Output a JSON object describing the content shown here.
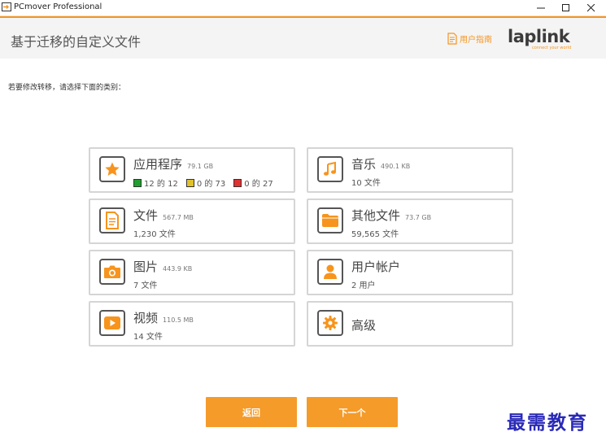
{
  "window": {
    "title": "PCmover Professional"
  },
  "header": {
    "title": "基于迁移的自定义文件",
    "guide_label": "用户指南",
    "logo_text": "laplink",
    "logo_tagline": "connect your world"
  },
  "instruction": "若要修改转移，请选择下面的类别：",
  "categories": [
    {
      "name": "应用程序",
      "size": "79.1 GB",
      "stats": [
        {
          "label": "12 的 12",
          "color": "#1fa02d"
        },
        {
          "label": "0 的 73",
          "color": "#e0c22a"
        },
        {
          "label": "0 的 27",
          "color": "#e03030"
        }
      ]
    },
    {
      "name": "音乐",
      "size": "490.1 KB",
      "sub": "10 文件"
    },
    {
      "name": "文件",
      "size": "567.7 MB",
      "sub": "1,230 文件"
    },
    {
      "name": "其他文件",
      "size": "73.7 GB",
      "sub": "59,565 文件"
    },
    {
      "name": "图片",
      "size": "443.9 KB",
      "sub": "7 文件"
    },
    {
      "name": "用户帐户",
      "sub": "2 用户"
    },
    {
      "name": "视频",
      "size": "110.5 MB",
      "sub": "14 文件"
    },
    {
      "name": "高级"
    }
  ],
  "buttons": {
    "back": "返回",
    "next": "下一个"
  },
  "watermark": "最需教育",
  "colors": {
    "accent": "#f7941d",
    "button": "#f59b2a",
    "card_border": "#d5d5d5"
  }
}
